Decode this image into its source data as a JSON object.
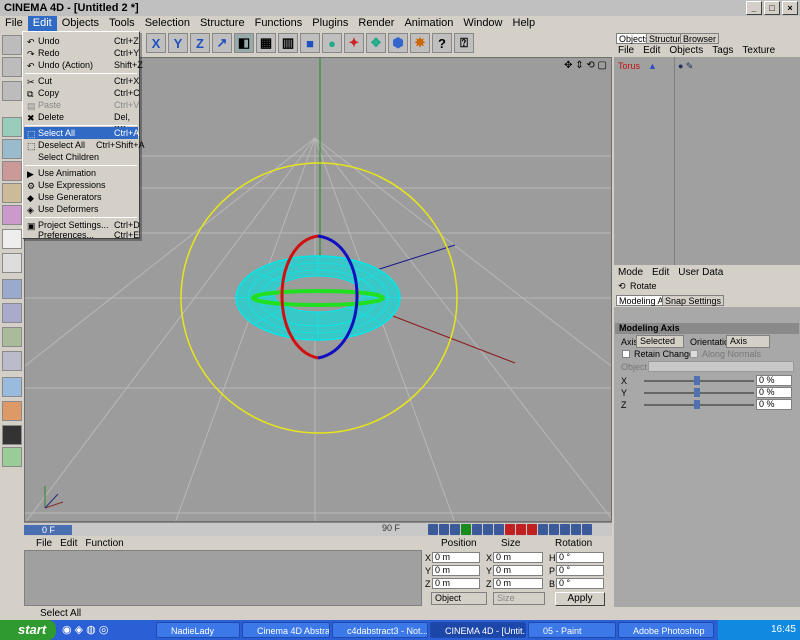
{
  "window": {
    "title": "CINEMA 4D - [Untitled 2 *]"
  },
  "menubar": {
    "items": [
      "File",
      "Edit",
      "Objects",
      "Tools",
      "Selection",
      "Structure",
      "Functions",
      "Plugins",
      "Render",
      "Animation",
      "Window",
      "Help"
    ],
    "active": "Edit"
  },
  "edit_menu": {
    "items": [
      {
        "label": "Undo",
        "shortcut": "Ctrl+Z"
      },
      {
        "label": "Redo",
        "shortcut": "Ctrl+Y"
      },
      {
        "label": "Undo (Action)",
        "shortcut": "Shift+Z"
      },
      {
        "label": "Cut",
        "shortcut": "Ctrl+X"
      },
      {
        "label": "Copy",
        "shortcut": "Ctrl+C"
      },
      {
        "label": "Paste",
        "shortcut": "Ctrl+V"
      },
      {
        "label": "Delete",
        "shortcut": "Del, BS"
      },
      {
        "label": "Select All",
        "shortcut": "Ctrl+A"
      },
      {
        "label": "Deselect All",
        "shortcut": "Ctrl+Shift+A"
      },
      {
        "label": "Select Children",
        "shortcut": ""
      },
      {
        "label": "Use Animation",
        "shortcut": ""
      },
      {
        "label": "Use Expressions",
        "shortcut": ""
      },
      {
        "label": "Use Generators",
        "shortcut": ""
      },
      {
        "label": "Use Deformers",
        "shortcut": ""
      },
      {
        "label": "Project Settings...",
        "shortcut": "Ctrl+D"
      },
      {
        "label": "Preferences...",
        "shortcut": "Ctrl+E"
      }
    ]
  },
  "timeline": {
    "current_frame": "0 F",
    "end_frame": "90 F"
  },
  "function_menu": {
    "items": [
      "File",
      "Edit",
      "Function"
    ]
  },
  "coords": {
    "headers": {
      "position": "Position",
      "size": "Size",
      "rotation": "Rotation"
    },
    "rows": [
      {
        "axis": "X",
        "pos": "0 m",
        "size_axis": "X",
        "size": "0 m",
        "rot_axis": "H",
        "rot": "0 °"
      },
      {
        "axis": "Y",
        "pos": "0 m",
        "size_axis": "Y",
        "size": "0 m",
        "rot_axis": "P",
        "rot": "0 °"
      },
      {
        "axis": "Z",
        "pos": "0 m",
        "size_axis": "Z",
        "size": "0 m",
        "rot_axis": "B",
        "rot": "0 °"
      }
    ],
    "mode": "Object",
    "size_mode": "Size",
    "apply": "Apply"
  },
  "status": {
    "text": "Select All"
  },
  "object_manager": {
    "tabs": [
      "Objects",
      "Structure",
      "Browser"
    ],
    "menu": [
      "File",
      "Edit",
      "Objects",
      "Tags",
      "Texture"
    ],
    "objects": [
      {
        "name": "Torus"
      }
    ]
  },
  "attribute_manager": {
    "menu": [
      "Mode",
      "Edit",
      "User Data"
    ],
    "tool_name": "Rotate",
    "tabs": [
      "Modeling Axis",
      "Snap Settings"
    ],
    "section": "Modeling Axis",
    "axis_label": "Axis",
    "axis_value": "Selected",
    "orientation_label": "Orientation",
    "orientation_value": "Axis",
    "retain_changes": "Retain Changes",
    "along_normals": "Along Normals",
    "object_label": "Object",
    "sliders": [
      {
        "label": "X",
        "value": "0 %"
      },
      {
        "label": "Y",
        "value": "0 %"
      },
      {
        "label": "Z",
        "value": "0 %"
      }
    ]
  },
  "taskbar": {
    "start": "start",
    "tasks": [
      "NadieLady",
      "Cinema 4D Abstrac...",
      "c4dabstract3 - Not...",
      "CINEMA 4D - [Untit...",
      "05 - Paint",
      "Adobe Photoshop"
    ],
    "active_task": "CINEMA 4D - [Untit...",
    "clock": "16:45"
  },
  "colors": {
    "accent": "#316ac5",
    "viewport": "#9c9c9c",
    "torus": "#00e0e0",
    "gizmo_ring": "#e0e020"
  }
}
